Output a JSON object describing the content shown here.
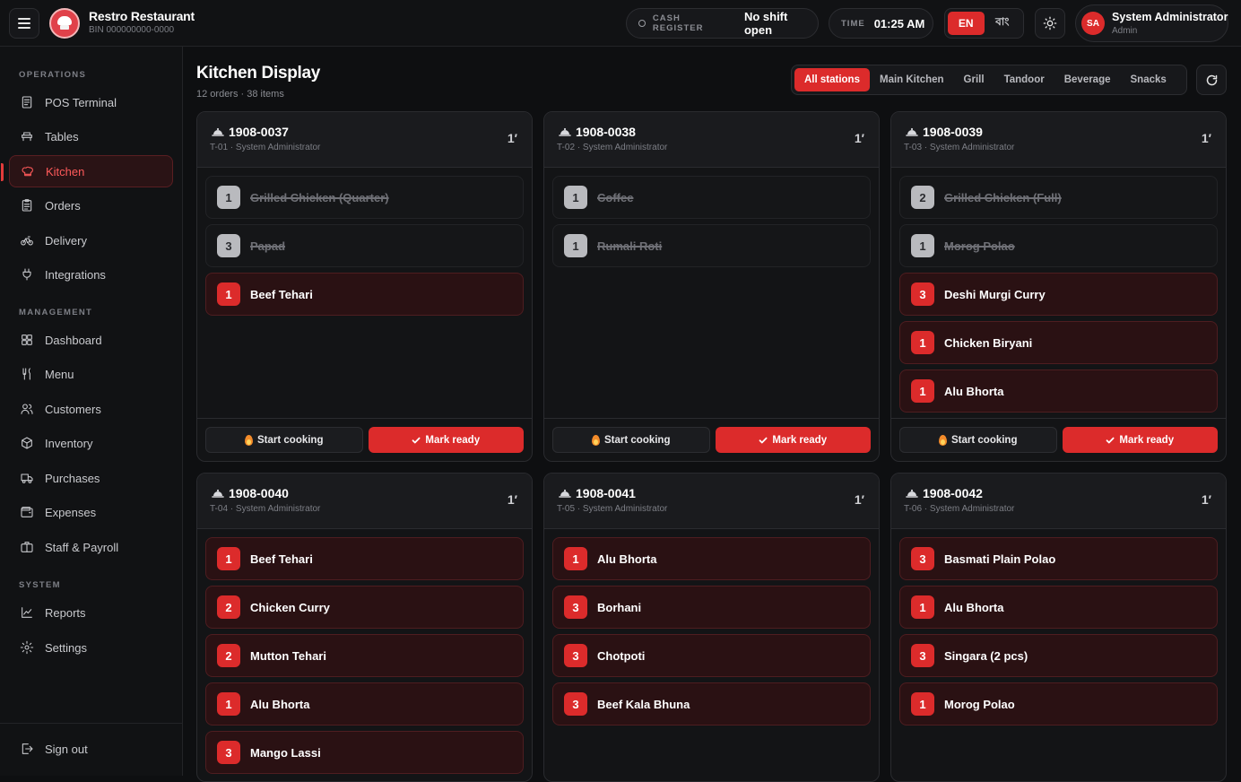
{
  "brand": {
    "name": "Restro Restaurant",
    "bin": "BIN 000000000-0000"
  },
  "header": {
    "cash_label": "CASH REGISTER",
    "cash_value": "No shift open",
    "time_label": "TIME",
    "time_value": "01:25 AM",
    "lang_en": "EN",
    "lang_bn": "বাং",
    "user_initials": "SA",
    "user_name": "System Administrator",
    "user_role": "Admin"
  },
  "sidebar": {
    "operations_label": "OPERATIONS",
    "management_label": "MANAGEMENT",
    "system_label": "SYSTEM",
    "operations": [
      {
        "label": "POS Terminal",
        "icon": "receipt-icon"
      },
      {
        "label": "Tables",
        "icon": "table-icon"
      },
      {
        "label": "Kitchen",
        "icon": "chef-hat-icon",
        "active": true
      },
      {
        "label": "Orders",
        "icon": "clipboard-icon"
      },
      {
        "label": "Delivery",
        "icon": "bike-icon"
      },
      {
        "label": "Integrations",
        "icon": "plug-icon"
      }
    ],
    "management": [
      {
        "label": "Dashboard",
        "icon": "grid-icon"
      },
      {
        "label": "Menu",
        "icon": "utensils-icon"
      },
      {
        "label": "Customers",
        "icon": "users-icon"
      },
      {
        "label": "Inventory",
        "icon": "box-icon"
      },
      {
        "label": "Purchases",
        "icon": "truck-icon"
      },
      {
        "label": "Expenses",
        "icon": "wallet-icon"
      },
      {
        "label": "Staff & Payroll",
        "icon": "briefcase-icon"
      }
    ],
    "system": [
      {
        "label": "Reports",
        "icon": "chart-line-icon"
      },
      {
        "label": "Settings",
        "icon": "gear-icon"
      }
    ],
    "sign_out": "Sign out"
  },
  "main": {
    "title": "Kitchen Display",
    "subtitle": "12 orders · 38 items",
    "stations": [
      "All stations",
      "Main Kitchen",
      "Grill",
      "Tandoor",
      "Beverage",
      "Snacks"
    ],
    "active_station": "All stations",
    "start_label": "Start cooking",
    "ready_label": "Mark ready"
  },
  "orders": [
    {
      "number": "1908-0037",
      "meta": "T-01 · System Administrator",
      "elapsed": "1′",
      "items": [
        {
          "qty": "1",
          "name": "Grilled Chicken (Quarter)",
          "done": true
        },
        {
          "qty": "3",
          "name": "Papad",
          "done": true
        },
        {
          "qty": "1",
          "name": "Beef Tehari",
          "done": false
        }
      ]
    },
    {
      "number": "1908-0038",
      "meta": "T-02 · System Administrator",
      "elapsed": "1′",
      "items": [
        {
          "qty": "1",
          "name": "Coffee",
          "done": true
        },
        {
          "qty": "1",
          "name": "Rumali Roti",
          "done": true
        }
      ]
    },
    {
      "number": "1908-0039",
      "meta": "T-03 · System Administrator",
      "elapsed": "1′",
      "items": [
        {
          "qty": "2",
          "name": "Grilled Chicken (Full)",
          "done": true
        },
        {
          "qty": "1",
          "name": "Morog Polao",
          "done": true
        },
        {
          "qty": "3",
          "name": "Deshi Murgi Curry",
          "done": false
        },
        {
          "qty": "1",
          "name": "Chicken Biryani",
          "done": false
        },
        {
          "qty": "1",
          "name": "Alu Bhorta",
          "done": false
        }
      ]
    },
    {
      "number": "1908-0040",
      "meta": "T-04 · System Administrator",
      "elapsed": "1′",
      "items": [
        {
          "qty": "1",
          "name": "Beef Tehari",
          "done": false
        },
        {
          "qty": "2",
          "name": "Chicken Curry",
          "done": false
        },
        {
          "qty": "2",
          "name": "Mutton Tehari",
          "done": false
        },
        {
          "qty": "1",
          "name": "Alu Bhorta",
          "done": false
        },
        {
          "qty": "3",
          "name": "Mango Lassi",
          "done": false
        }
      ]
    },
    {
      "number": "1908-0041",
      "meta": "T-05 · System Administrator",
      "elapsed": "1′",
      "items": [
        {
          "qty": "1",
          "name": "Alu Bhorta",
          "done": false
        },
        {
          "qty": "3",
          "name": "Borhani",
          "done": false
        },
        {
          "qty": "3",
          "name": "Chotpoti",
          "done": false
        },
        {
          "qty": "3",
          "name": "Beef Kala Bhuna",
          "done": false
        }
      ]
    },
    {
      "number": "1908-0042",
      "meta": "T-06 · System Administrator",
      "elapsed": "1′",
      "items": [
        {
          "qty": "3",
          "name": "Basmati Plain Polao",
          "done": false
        },
        {
          "qty": "1",
          "name": "Alu Bhorta",
          "done": false
        },
        {
          "qty": "3",
          "name": "Singara (2 pcs)",
          "done": false
        },
        {
          "qty": "1",
          "name": "Morog Polao",
          "done": false
        }
      ]
    }
  ]
}
